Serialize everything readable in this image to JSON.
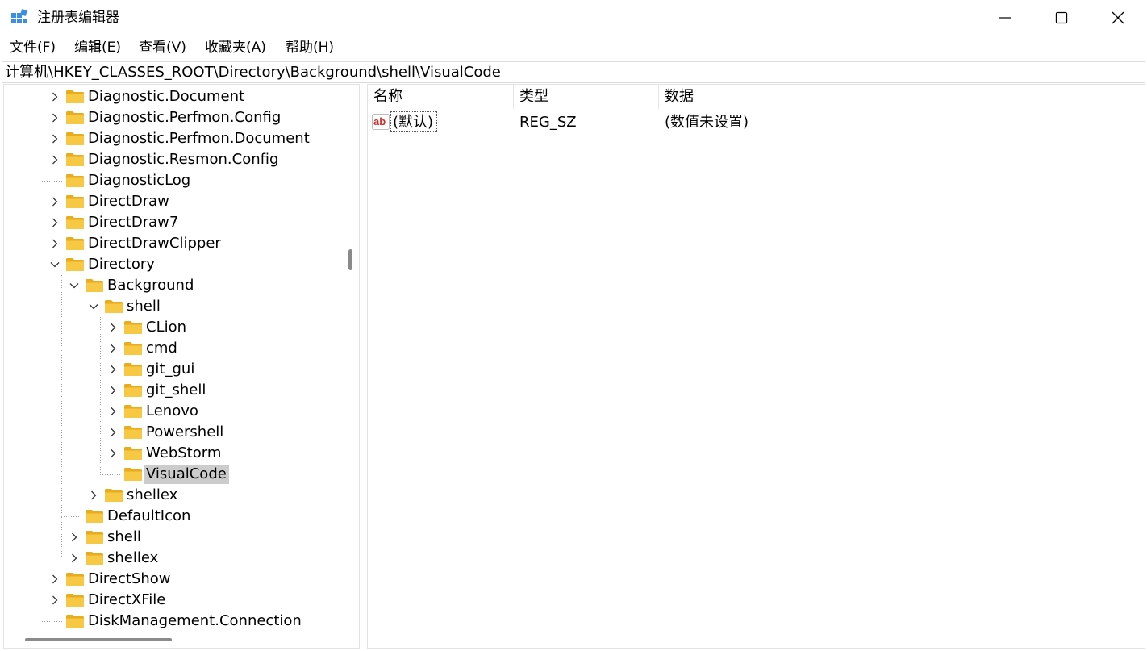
{
  "window": {
    "title": "注册表编辑器",
    "icons": {
      "app": "registry-editor-icon",
      "minimize": "minimize-icon",
      "maximize": "maximize-icon",
      "close": "close-icon"
    }
  },
  "menu": [
    "文件(F)",
    "编辑(E)",
    "查看(V)",
    "收藏夹(A)",
    "帮助(H)"
  ],
  "address": "计算机\\HKEY_CLASSES_ROOT\\Directory\\Background\\shell\\VisualCode",
  "tree": {
    "items": [
      {
        "label": "Diagnostic.Document",
        "level": 0,
        "expander": "collapsed"
      },
      {
        "label": "Diagnostic.Perfmon.Config",
        "level": 0,
        "expander": "collapsed"
      },
      {
        "label": "Diagnostic.Perfmon.Document",
        "level": 0,
        "expander": "collapsed"
      },
      {
        "label": "Diagnostic.Resmon.Config",
        "level": 0,
        "expander": "collapsed"
      },
      {
        "label": "DiagnosticLog",
        "level": 0,
        "expander": "none"
      },
      {
        "label": "DirectDraw",
        "level": 0,
        "expander": "collapsed"
      },
      {
        "label": "DirectDraw7",
        "level": 0,
        "expander": "collapsed"
      },
      {
        "label": "DirectDrawClipper",
        "level": 0,
        "expander": "collapsed"
      },
      {
        "label": "Directory",
        "level": 0,
        "expander": "expanded"
      },
      {
        "label": "Background",
        "level": 1,
        "expander": "expanded"
      },
      {
        "label": "shell",
        "level": 2,
        "expander": "expanded"
      },
      {
        "label": "CLion",
        "level": 3,
        "expander": "collapsed"
      },
      {
        "label": "cmd",
        "level": 3,
        "expander": "collapsed"
      },
      {
        "label": "git_gui",
        "level": 3,
        "expander": "collapsed"
      },
      {
        "label": "git_shell",
        "level": 3,
        "expander": "collapsed"
      },
      {
        "label": "Lenovo",
        "level": 3,
        "expander": "collapsed"
      },
      {
        "label": "Powershell",
        "level": 3,
        "expander": "collapsed"
      },
      {
        "label": "WebStorm",
        "level": 3,
        "expander": "collapsed"
      },
      {
        "label": "VisualCode",
        "level": 3,
        "expander": "none",
        "selected": true
      },
      {
        "label": "shellex",
        "level": 2,
        "expander": "collapsed"
      },
      {
        "label": "DefaultIcon",
        "level": 1,
        "expander": "none"
      },
      {
        "label": "shell",
        "level": 1,
        "expander": "collapsed"
      },
      {
        "label": "shellex",
        "level": 1,
        "expander": "collapsed"
      },
      {
        "label": "DirectShow",
        "level": 0,
        "expander": "collapsed"
      },
      {
        "label": "DirectXFile",
        "level": 0,
        "expander": "collapsed"
      },
      {
        "label": "DiskManagement.Connection",
        "level": 0,
        "expander": "none"
      }
    ]
  },
  "values": {
    "headers": {
      "name": "名称",
      "type": "类型",
      "data": "数据"
    },
    "rows": [
      {
        "icon": "string-value-icon",
        "name": "(默认)",
        "type": "REG_SZ",
        "data": "(数值未设置)"
      }
    ]
  },
  "colors": {
    "folder": "#f7c843",
    "folder_tab": "#e9ac1c",
    "selection": "#cccccc",
    "ab_icon": "#d0302a"
  }
}
